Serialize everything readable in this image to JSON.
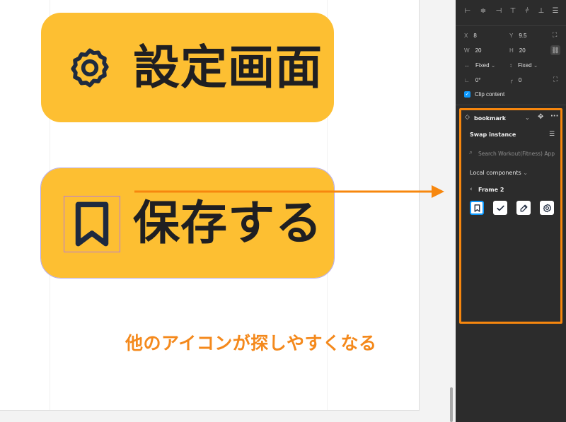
{
  "canvas": {
    "button_settings_label": "設定画面",
    "button_save_label": "保存する",
    "caption": "他のアイコンが探しやすくなる"
  },
  "panel": {
    "x_label": "X",
    "x_value": "8",
    "y_label": "Y",
    "y_value": "9.5",
    "w_label": "W",
    "w_value": "20",
    "h_label": "H",
    "h_value": "20",
    "width_mode": "Fixed",
    "height_mode": "Fixed",
    "rotation": "0°",
    "corner_radius": "0",
    "clip_content_label": "Clip content",
    "component_name": "bookmark",
    "swap_title": "Swap instance",
    "search_placeholder": "Search Workout(Fitness) App",
    "library_label": "Local components",
    "frame_label": "Frame 2",
    "icons": [
      "bookmark-icon",
      "check-icon",
      "pencil-icon",
      "gear-icon"
    ]
  },
  "colors": {
    "button_bg": "#fdbf32",
    "accent_orange": "#f7870e",
    "panel_bg": "#2c2c2c",
    "selection_blue": "#0d99ff"
  }
}
